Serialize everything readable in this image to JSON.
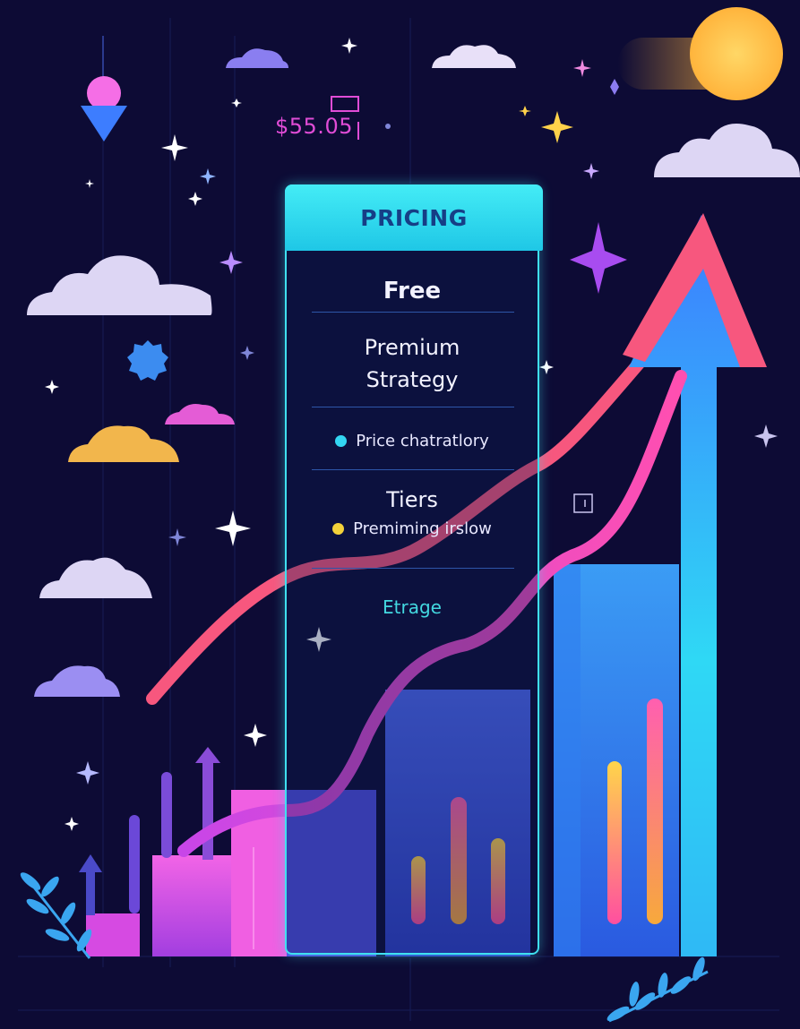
{
  "price_tag": "$55.05",
  "card": {
    "title": "PRICING",
    "items": [
      {
        "text": "Free"
      },
      {
        "text": "Premium\nStrategy"
      },
      {
        "text": "Price chatratlory",
        "dot_color": "#33d6f2"
      },
      {
        "text": "Tiers"
      },
      {
        "text": "Premiming irslow",
        "dot_color": "#f4d23a"
      },
      {
        "text": "Etrage"
      }
    ]
  },
  "colors": {
    "background": "#0d0b35",
    "card_border": "#3fe0f0",
    "accent_pink": "#ee4fd0",
    "accent_coral": "#f7577e",
    "sun": "#ffc64e"
  },
  "icons": [
    "sun-icon",
    "cloud-icon",
    "sparkle-icon",
    "map-pin-icon",
    "growth-arrow-icon",
    "leaf-icon",
    "gear-icon"
  ]
}
